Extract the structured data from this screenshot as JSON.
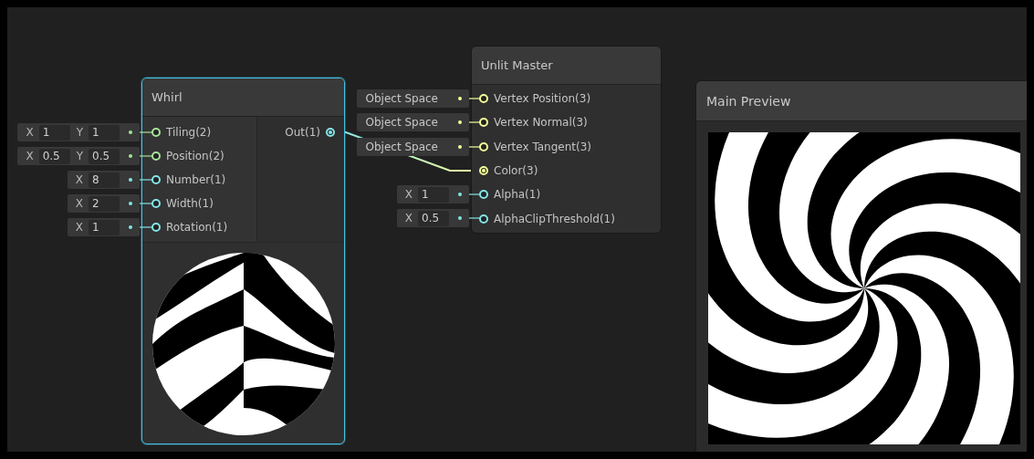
{
  "graph": {
    "nodes": [
      {
        "kind": "whirl",
        "title": "Whirl",
        "selected": true,
        "inputs": [
          {
            "label": "Tiling(2)",
            "color": "#a6e39b",
            "connected": false,
            "field": {
              "kind": "vector",
              "components": [
                {
                  "axis": "X",
                  "value": "1"
                },
                {
                  "axis": "Y",
                  "value": "1"
                }
              ]
            }
          },
          {
            "label": "Position(2)",
            "color": "#a6e39b",
            "connected": false,
            "field": {
              "kind": "vector",
              "components": [
                {
                  "axis": "X",
                  "value": "0.5"
                },
                {
                  "axis": "Y",
                  "value": "0.5"
                }
              ]
            }
          },
          {
            "label": "Number(1)",
            "color": "#84e4e7",
            "connected": false,
            "field": {
              "kind": "vector",
              "components": [
                {
                  "axis": "X",
                  "value": "8"
                }
              ]
            }
          },
          {
            "label": "Width(1)",
            "color": "#84e4e7",
            "connected": false,
            "field": {
              "kind": "vector",
              "components": [
                {
                  "axis": "X",
                  "value": "2"
                }
              ]
            }
          },
          {
            "label": "Rotation(1)",
            "color": "#84e4e7",
            "connected": false,
            "field": {
              "kind": "vector",
              "components": [
                {
                  "axis": "X",
                  "value": "1"
                }
              ]
            }
          }
        ],
        "outputs": [
          {
            "label": "Out(1)",
            "color": "#84e4e7",
            "connected": true
          }
        ]
      },
      {
        "kind": "master",
        "title": "Unlit Master",
        "selected": false,
        "inputs": [
          {
            "label": "Vertex Position(3)",
            "color": "#f6ff9a",
            "connected": false,
            "field": {
              "kind": "space",
              "value": "Object Space"
            }
          },
          {
            "label": "Vertex Normal(3)",
            "color": "#f6ff9a",
            "connected": false,
            "field": {
              "kind": "space",
              "value": "Object Space"
            }
          },
          {
            "label": "Vertex Tangent(3)",
            "color": "#f6ff9a",
            "connected": false,
            "field": {
              "kind": "space",
              "value": "Object Space"
            }
          },
          {
            "label": "Color(3)",
            "color": "#f6ff9a",
            "connected": true
          },
          {
            "label": "Alpha(1)",
            "color": "#84e4e7",
            "connected": false,
            "field": {
              "kind": "vector",
              "components": [
                {
                  "axis": "X",
                  "value": "1"
                }
              ]
            }
          },
          {
            "label": "AlphaClipThreshold(1)",
            "color": "#84e4e7",
            "connected": false,
            "field": {
              "kind": "vector",
              "components": [
                {
                  "axis": "X",
                  "value": "0.5"
                }
              ]
            }
          }
        ]
      },
      {
        "kind": "preview",
        "title": "Main Preview",
        "selected": false
      }
    ]
  }
}
